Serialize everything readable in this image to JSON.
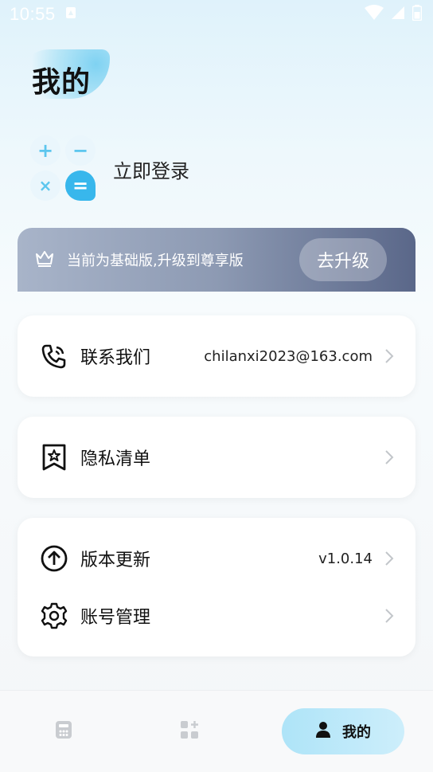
{
  "status_bar": {
    "time": "10:55"
  },
  "page": {
    "title": "我的"
  },
  "login": {
    "label": "立即登录"
  },
  "upgrade": {
    "text": "当前为基础版,升级到尊享版",
    "button": "去升级"
  },
  "menu": {
    "contact": {
      "label": "联系我们",
      "value": "chilanxi2023@163.com"
    },
    "privacy": {
      "label": "隐私清单"
    },
    "update": {
      "label": "版本更新",
      "value": "v1.0.14"
    },
    "account": {
      "label": "账号管理"
    }
  },
  "tab_bar": {
    "tabs": [
      {
        "icon": "calculator-icon"
      },
      {
        "icon": "apps-add-icon"
      },
      {
        "icon": "person-icon",
        "label": "我的",
        "active": true
      }
    ]
  },
  "colors": {
    "accent": "#38b7ec",
    "banner_start": "#a8b4c9",
    "banner_end": "#5a6789"
  }
}
